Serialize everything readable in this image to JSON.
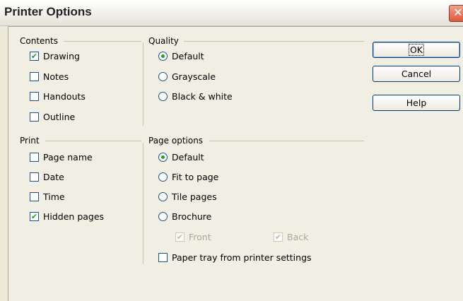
{
  "window": {
    "title": "Printer Options",
    "close_glyph": "✕"
  },
  "contents": {
    "label": "Contents",
    "items": [
      {
        "label": "Drawing",
        "checked": true
      },
      {
        "label": "Notes",
        "checked": false
      },
      {
        "label": "Handouts",
        "checked": false
      },
      {
        "label": "Outline",
        "checked": false
      }
    ]
  },
  "quality": {
    "label": "Quality",
    "options": [
      "Default",
      "Grayscale",
      "Black & white"
    ],
    "selected": "Default"
  },
  "print": {
    "label": "Print",
    "items": [
      {
        "label": "Page name",
        "checked": false
      },
      {
        "label": "Date",
        "checked": false
      },
      {
        "label": "Time",
        "checked": false
      },
      {
        "label": "Hidden pages",
        "checked": true
      }
    ]
  },
  "page_options": {
    "label": "Page options",
    "options": [
      "Default",
      "Fit to page",
      "Tile pages",
      "Brochure"
    ],
    "selected": "Default",
    "front_label": "Front",
    "back_label": "Back",
    "paper_tray_label": "Paper tray from printer settings"
  },
  "buttons": {
    "ok": "OK",
    "cancel": "Cancel",
    "help": "Help"
  },
  "check_glyph": "✔"
}
